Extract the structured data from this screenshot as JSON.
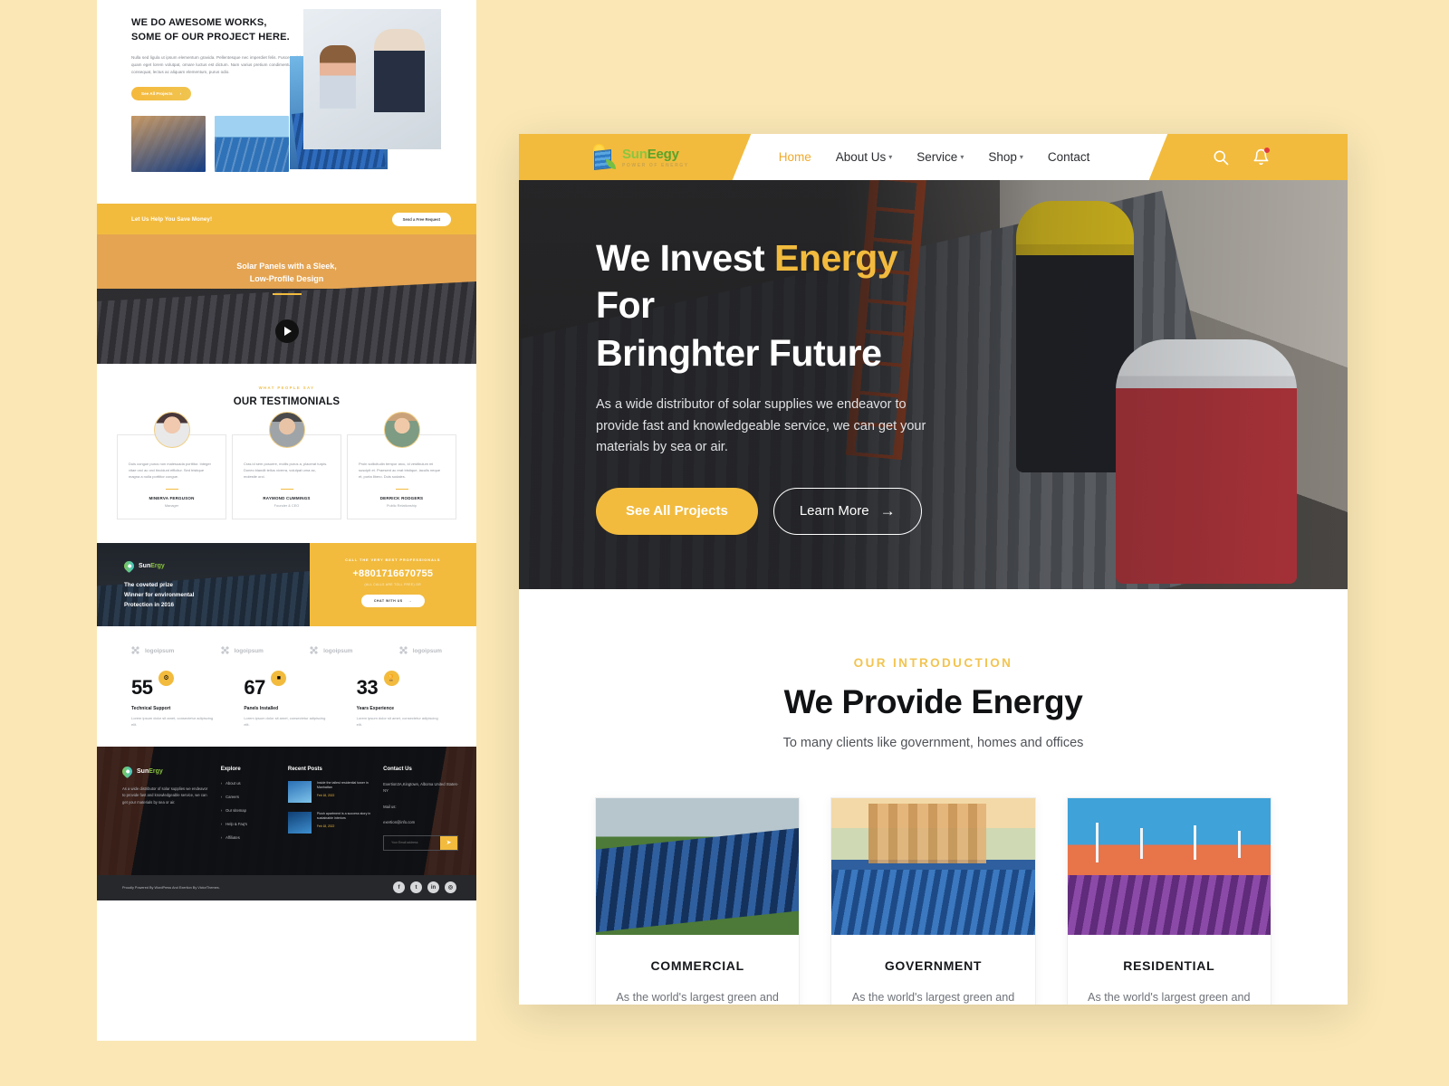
{
  "site": {
    "brand_primary": "#f2bb3e",
    "brand_green": "#8bc63f",
    "logo_name_1": "Sun",
    "logo_name_2": "Eegy",
    "logo_tagline": "POWER OF ENERGY"
  },
  "header": {
    "nav": [
      {
        "label": "Home",
        "active": true,
        "caret": false
      },
      {
        "label": "About Us",
        "active": false,
        "caret": true
      },
      {
        "label": "Service",
        "active": false,
        "caret": true
      },
      {
        "label": "Shop",
        "active": false,
        "caret": true
      },
      {
        "label": "Contact",
        "active": false,
        "caret": false
      }
    ],
    "search_icon": "search-icon",
    "bell_icon": "bell-icon"
  },
  "hero": {
    "title_part1": "We Invest ",
    "title_highlight": "Energy",
    "title_part2": " For",
    "title_line2": "Bringhter Future",
    "paragraph": "As a wide distributor of solar supplies we endeavor to provide fast and knowledgeable service, we can get your materials by sea or air.",
    "primary_btn": "See All Projects",
    "secondary_btn": "Learn More",
    "secondary_btn_arrow": "→"
  },
  "intro": {
    "eyebrow": "OUR INTRODUCTION",
    "title": "We Provide Energy",
    "subtitle": "To many clients like government, homes and offices",
    "cards": [
      {
        "title": "COMMERCIAL",
        "text": "As the world's largest green and clean egerngy specialist of the printing and typesetting industry. Lorem has been the industry."
      },
      {
        "title": "GOVERNMENT",
        "text": "As the world's largest green and clean egerngy specialist of the printing and typesetting industry. Lorem has been the industry."
      },
      {
        "title": "RESIDENTIAL",
        "text": "As the world's largest green and clean egerngy specialist of the printing and typesetting industry. Lorem has been the industry."
      }
    ]
  },
  "preview": {
    "works": {
      "title_line1": "WE DO AWESOME WORKS,",
      "title_line2": "SOME OF OUR PROJECT HERE.",
      "paragraph": "Nulla sed ligula ut ipsum elementum gravida. Pellentesque nec imperdiet felis. Fusce sodales quam eget lorem volutpat, ornare luctus est dictum. Nam varius pretium condimentum. Duis consequat, lectus ac aliquam elementum, purus odio.",
      "button": "See All Projects",
      "button_arrow": "›"
    },
    "saveband": {
      "text": "Let Us Help You Save Money!",
      "button": "Send a Free Request"
    },
    "video": {
      "title_line1": "Solar Panels with a Sleek,",
      "title_line2": "Low-Profile Design",
      "play_icon": "play-icon"
    },
    "testimonials": {
      "eyebrow": "WHAT PEOPLE SAY",
      "title": "OUR TESTIMONIALS",
      "items": [
        {
          "quote": "Duis congue purus non malesuada porttitor. Integer vitae orci ac orci tincidunt efficitur. Sed tristique magna a nulla porttitor congue.",
          "name": "MINERVA FERGUSON",
          "role": "Manager"
        },
        {
          "quote": "Cras id sem posuere, mollis purus a, placerat turpis. Donec blandit tellus viverra, volutpat urna ac, molestie orci.",
          "name": "RAYMOND CUMMINGS",
          "role": "Founder & CEO"
        },
        {
          "quote": "Proin sollicitudin tempor arcu, id vestibulum mi suscipit et. Praesent ac erat tristique, iaculis neque et, porta libero. Duis sodales.",
          "name": "DERRICK RODGERS",
          "role": "Public Relationship"
        }
      ]
    },
    "cta": {
      "logo_1": "Sun",
      "logo_2": "Ergy",
      "headline_l1": "The coveted prize",
      "headline_l2": "Winner for environmental",
      "headline_l3": "Protection in 2016",
      "kicker": "CALL THE VERY BEST PROFESSIONALS",
      "phone": "+8801716670755",
      "note": "(ALL CALLS ARE TOLL FREE) OR",
      "button": "CHAT WITH US",
      "button_arrow": "→"
    },
    "stats": {
      "logos": [
        "logoipsum",
        "logoipsum",
        "logoipsum",
        "logoipsum"
      ],
      "counters": [
        {
          "number": "55",
          "icon": "gear-icon",
          "label": "Technical Support",
          "desc": "Lorem ipsum dolor sit amet, consectetur adipiscing elit."
        },
        {
          "number": "67",
          "icon": "panel-icon",
          "label": "Panels Installed",
          "desc": "Lorem ipsum dolor sit amet, consectetur adipiscing elit."
        },
        {
          "number": "33",
          "icon": "award-icon",
          "label": "Years Experience",
          "desc": "Lorem ipsum dolor sit amet, consectetur adipiscing elit."
        }
      ]
    },
    "footer": {
      "logo_1": "Sun",
      "logo_2": "Ergy",
      "about": "As a wide distributor of solar supplies we endeavor to provide fast and knowledgeable service, we can get your materials by sea or air.",
      "explore_heading": "Explore",
      "explore_links": [
        "About us",
        "Careers",
        "Our sitemap",
        "Help & Faq's",
        "Affiliates"
      ],
      "posts_heading": "Recent Posts",
      "posts": [
        {
          "title": "Inside the tallest residential tower in Manhattan",
          "date": "Feb 18, 2022"
        },
        {
          "title": "Plush apartment is a success story in sustainable interiors",
          "date": "Feb 18, 2022"
        }
      ],
      "contact_heading": "Contact Us",
      "address": "Exertion3A,Kingtown, Alboma United States-NY",
      "mail_label": "Mail us:",
      "mail": "exertion@info.com",
      "subscribe_placeholder": "Your Email address",
      "subscribe_icon": "send-icon",
      "copyright": "Proudly Powered By WordPress And Exertion By VictorThemes.",
      "social": [
        "f",
        "t",
        "in",
        "◎"
      ]
    }
  }
}
